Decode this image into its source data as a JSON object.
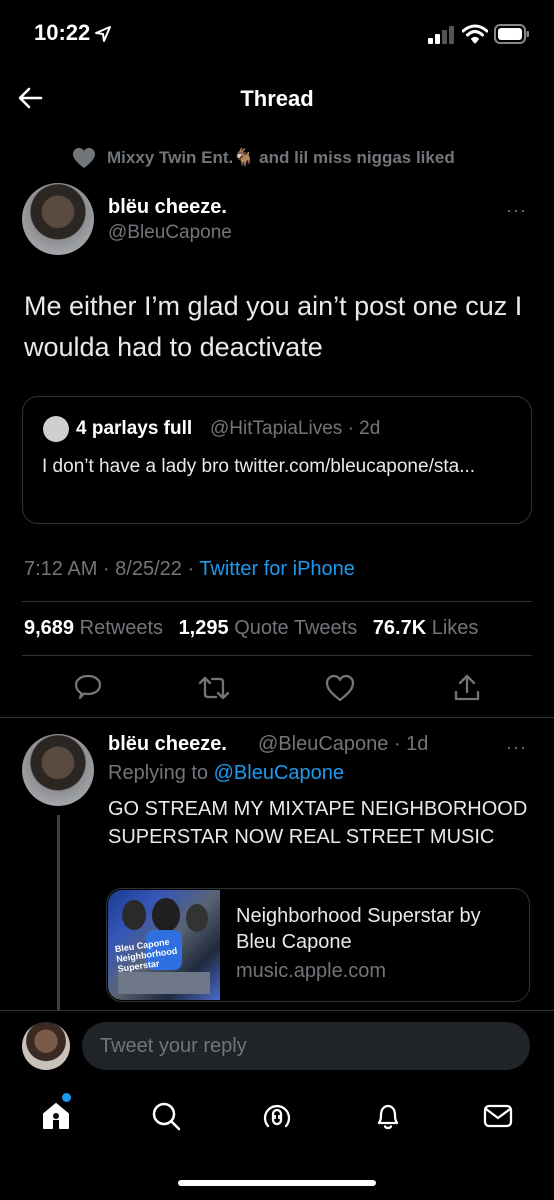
{
  "status_bar": {
    "time": "10:22"
  },
  "nav": {
    "title": "Thread"
  },
  "social_context": {
    "text": "Mixxy Twin Ent.🐐 and lil miss niggas liked"
  },
  "main_tweet": {
    "name": "blëu cheeze.",
    "handle": "@BleuCapone",
    "more": "···",
    "text": "Me either I’m glad you ain’t post one cuz I woulda had to deactivate",
    "quote": {
      "name": "4 parlays full",
      "meta": "@HitTapiaLives · 2d",
      "text": "I don’t have a lady bro twitter.com/bleucapone/sta..."
    },
    "time": "7:12 AM · 8/25/22 · ",
    "source": "Twitter for iPhone",
    "stats": {
      "retweets_count": "9,689",
      "retweets_label": "Retweets",
      "quotes_count": "1,295",
      "quotes_label": "Quote Tweets",
      "likes_count": "76.7K",
      "likes_label": "Likes"
    }
  },
  "reply_tweet": {
    "name": "blëu cheeze.",
    "meta": "@BleuCapone · 1d",
    "more": "···",
    "replying_prefix": "Replying to ",
    "replying_handle": "@BleuCapone",
    "text": "GO STREAM MY MIXTAPE NEIGHBORHOOD SUPERSTAR NOW REAL STREET MUSIC",
    "card": {
      "title": "Neighborhood Superstar by Bleu Capone",
      "domain": "music.apple.com",
      "image_label": "Bleu Capone Neighborhood Superstar"
    }
  },
  "compose": {
    "placeholder": "Tweet your reply"
  },
  "colors": {
    "accent": "#1d9bf0",
    "background": "#000000",
    "muted": "#71767b",
    "divider": "#2f3336"
  },
  "icons": [
    "location-arrow-icon",
    "signal-icon",
    "wifi-icon",
    "battery-icon",
    "back-arrow-icon",
    "heart-icon",
    "reply-icon",
    "retweet-icon",
    "like-icon",
    "share-icon",
    "home-icon",
    "search-icon",
    "spaces-icon",
    "notifications-icon",
    "messages-icon"
  ]
}
